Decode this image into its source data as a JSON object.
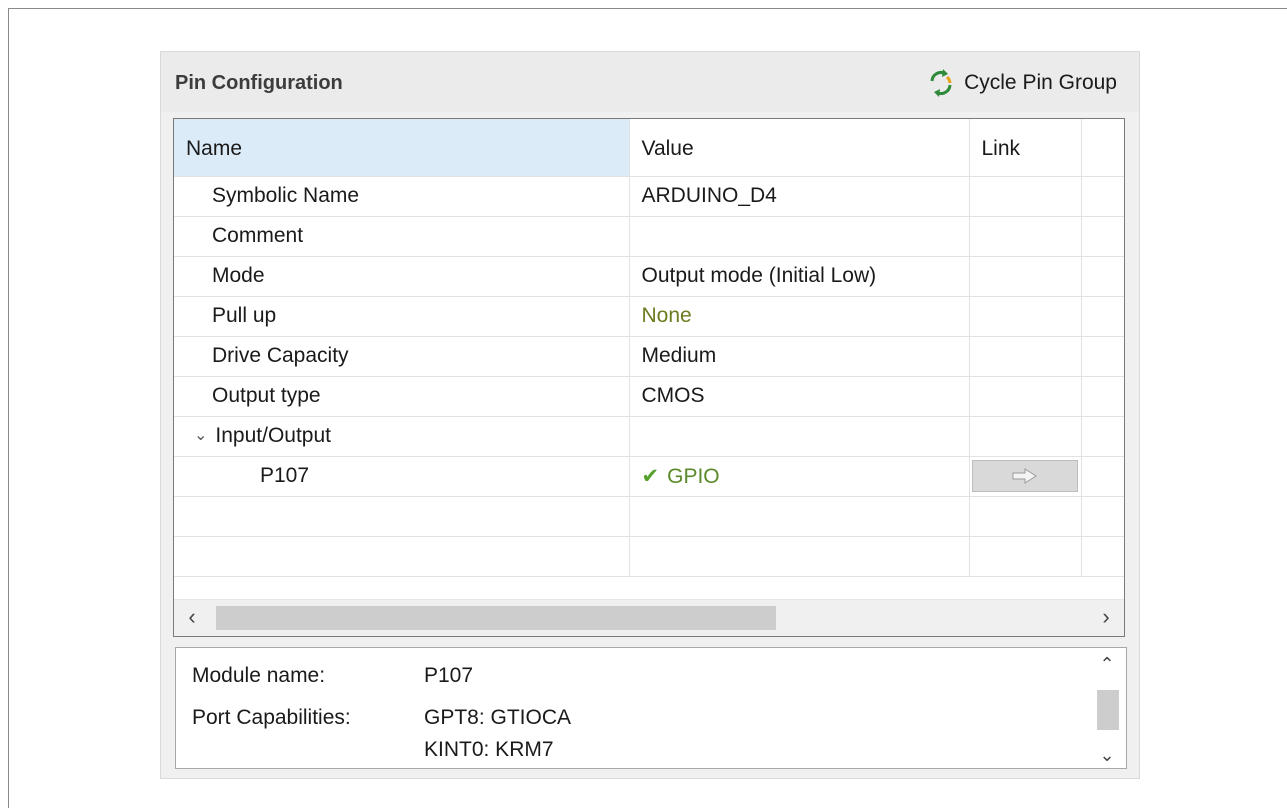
{
  "panel": {
    "title": "Pin Configuration",
    "cycle_button_label": "Cycle Pin Group",
    "cycle_icon": "cycle-arrows-icon"
  },
  "table": {
    "columns": [
      "Name",
      "Value",
      "Link"
    ],
    "rows": [
      {
        "name": "Symbolic Name",
        "value": "ARDUINO_D4"
      },
      {
        "name": "Comment",
        "value": ""
      },
      {
        "name": "Mode",
        "value": "Output mode (Initial Low)"
      },
      {
        "name": "Pull up",
        "value": "None"
      },
      {
        "name": "Drive Capacity",
        "value": "Medium"
      },
      {
        "name": "Output type",
        "value": "CMOS"
      }
    ],
    "group": {
      "name": "Input/Output",
      "expanded": true
    },
    "child": {
      "name": "P107",
      "value": "GPIO",
      "status_icon": "check-icon",
      "link_icon": "arrow-right-icon"
    }
  },
  "info": {
    "module_label": "Module name:",
    "module_value": "P107",
    "capabilities_label": "Port Capabilities:",
    "capabilities": [
      "GPT8: GTIOCA",
      "KINT0: KRM7"
    ]
  },
  "colors": {
    "header_selected": "#dcebf8",
    "value_none": "#6b7d1f",
    "value_gpio": "#5a8a2a",
    "check": "#56a02c"
  }
}
